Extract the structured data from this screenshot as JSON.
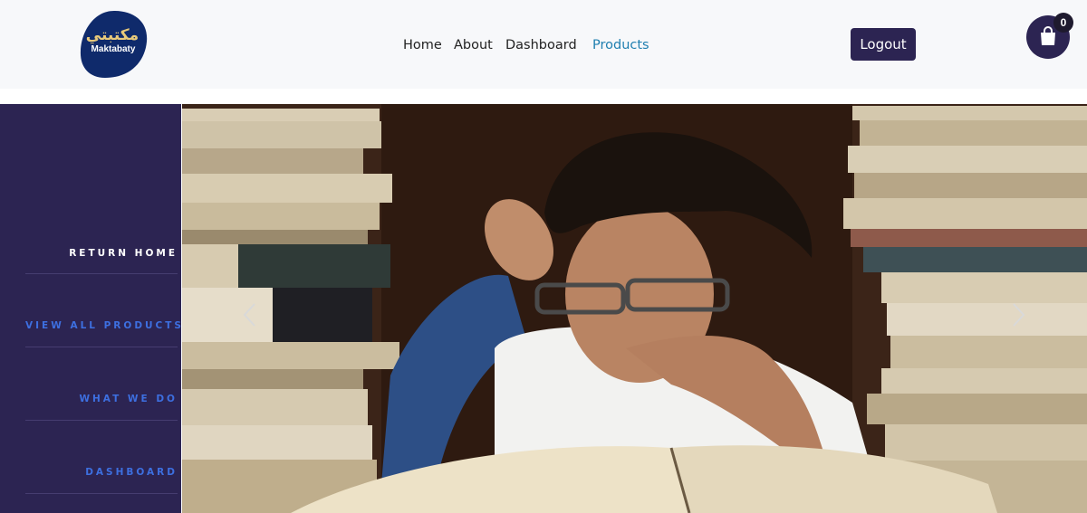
{
  "header": {
    "logo": {
      "arabic": "مكتبتي",
      "latin": "Maktabaty",
      "color": "#0f2a6b"
    },
    "nav": [
      {
        "label": "Home",
        "active": false
      },
      {
        "label": "About",
        "active": false
      },
      {
        "label": "Dashboard",
        "active": false
      },
      {
        "label": "Products",
        "active": true
      }
    ],
    "logout_label": "Logout",
    "cart": {
      "icon": "shopping-bag-icon",
      "count": "0"
    }
  },
  "sidebar": {
    "items": [
      {
        "label": "RETURN HOME"
      },
      {
        "label": "VIEW ALL PRODUCTS"
      },
      {
        "label": "WHAT WE DO"
      },
      {
        "label": "DASHBOARD"
      }
    ]
  },
  "carousel": {
    "prev_icon": "chevron-left-icon",
    "next_icon": "chevron-right-icon"
  },
  "colors": {
    "accent": "#2c2452",
    "link": "#3d6fe0",
    "active_nav": "#1f7fb0"
  }
}
